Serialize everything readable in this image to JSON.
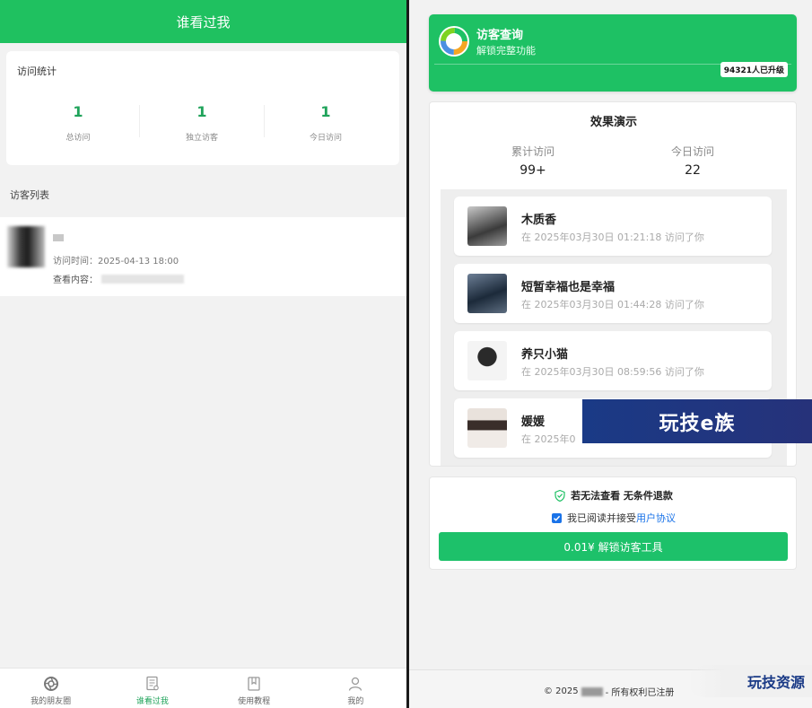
{
  "left": {
    "header_title": "谁看过我",
    "stats": {
      "title": "访问统计",
      "items": [
        {
          "value": "1",
          "label": "总访问"
        },
        {
          "value": "1",
          "label": "独立访客"
        },
        {
          "value": "1",
          "label": "今日访问"
        }
      ]
    },
    "list_title": "访客列表",
    "visitor": {
      "time": "访问时间：2025-04-13 18:00",
      "content_label": "查看内容："
    },
    "tabs": [
      {
        "label": "我的朋友圈",
        "icon": "aperture-icon",
        "active": false
      },
      {
        "label": "谁看过我",
        "icon": "document-eye-icon",
        "active": true
      },
      {
        "label": "使用教程",
        "icon": "bookmark-icon",
        "active": false
      },
      {
        "label": "我的",
        "icon": "user-icon",
        "active": false
      }
    ]
  },
  "right": {
    "promo": {
      "title": "访客查询",
      "subtitle": "解锁完整功能",
      "badge": "94321人已升级"
    },
    "demo": {
      "title": "效果演示",
      "stats": [
        {
          "label": "累计访问",
          "value": "99+"
        },
        {
          "label": "今日访问",
          "value": "22"
        }
      ],
      "items": [
        {
          "name": "木质香",
          "desc": "在 2025年03月30日 01:21:18 访问了你"
        },
        {
          "name": "短暂幸福也是幸福",
          "desc": "在 2025年03月30日 01:44:28 访问了你"
        },
        {
          "name": "养只小猫",
          "desc": "在 2025年03月30日 08:59:56 访问了你"
        },
        {
          "name": "媛媛",
          "desc": "在 2025年0"
        }
      ]
    },
    "buy": {
      "guarantee": "若无法查看 无条件退款",
      "agree_text": "我已阅读并接受",
      "agree_link": "用户协议",
      "button": "0.01¥ 解锁访客工具"
    },
    "footer": {
      "prefix": "© 2025",
      "suffix": "- 所有权利已注册"
    }
  },
  "watermarks": {
    "top": "玩技e族",
    "bottom": "玩技资源"
  },
  "colors": {
    "green": "#1fc160",
    "link_blue": "#1a73e8",
    "watermark_blue": "#1a3a86"
  }
}
